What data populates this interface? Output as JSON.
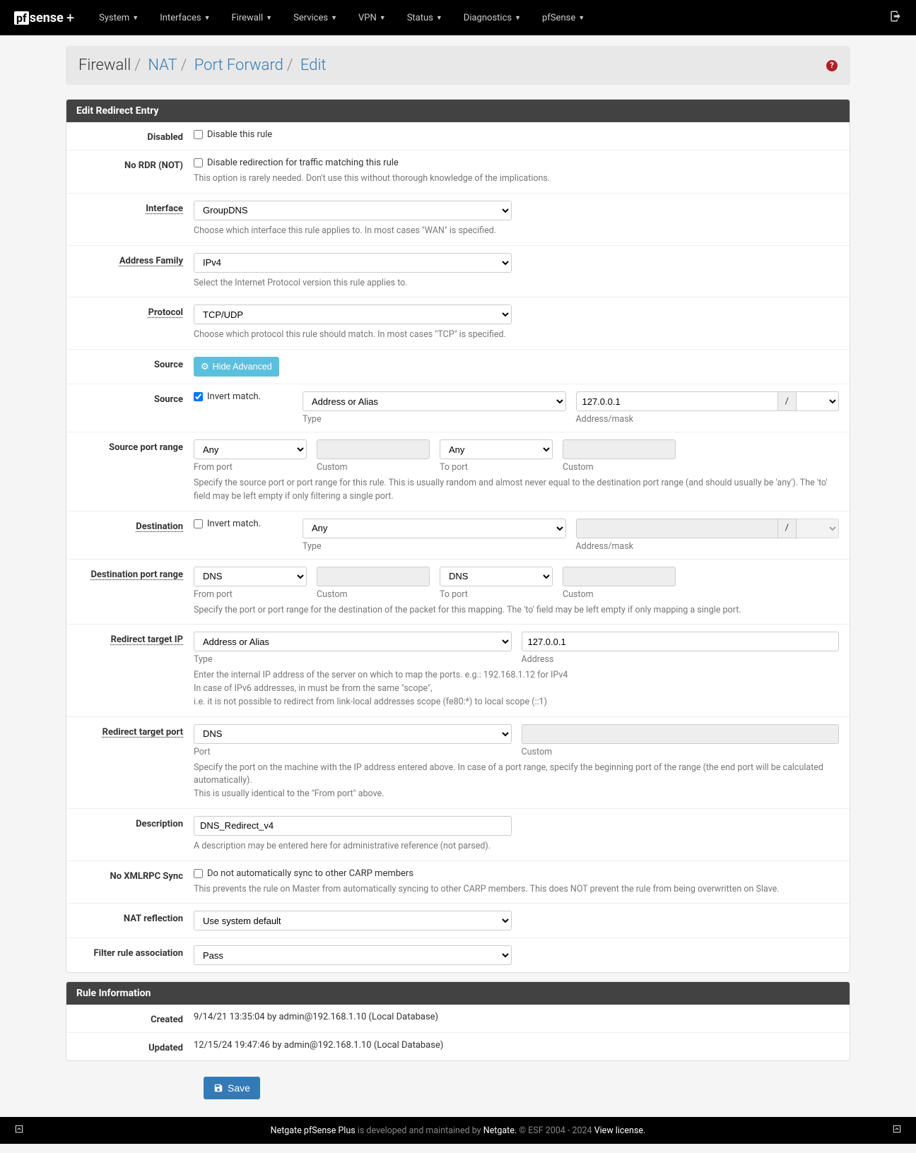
{
  "nav": {
    "logo_prefix": "pf",
    "logo_text": "sense",
    "logo_suffix": "+",
    "items": [
      "System",
      "Interfaces",
      "Firewall",
      "Services",
      "VPN",
      "Status",
      "Diagnostics",
      "pfSense"
    ]
  },
  "breadcrumb": {
    "parts": [
      "Firewall",
      "NAT",
      "Port Forward",
      "Edit"
    ]
  },
  "panel1_title": "Edit Redirect Entry",
  "panel2_title": "Rule Information",
  "fields": {
    "disabled": {
      "label": "Disabled",
      "cb_label": "Disable this rule",
      "checked": false
    },
    "nordr": {
      "label": "No RDR (NOT)",
      "cb_label": "Disable redirection for traffic matching this rule",
      "checked": false,
      "help": "This option is rarely needed. Don't use this without thorough knowledge of the implications."
    },
    "interface": {
      "label": "Interface",
      "value": "GroupDNS",
      "help": "Choose which interface this rule applies to. In most cases \"WAN\" is specified."
    },
    "addrfam": {
      "label": "Address Family",
      "value": "IPv4",
      "help": "Select the Internet Protocol version this rule applies to."
    },
    "protocol": {
      "label": "Protocol",
      "value": "TCP/UDP",
      "help": "Choose which protocol this rule should match. In most cases \"TCP\" is specified."
    },
    "source_btn": {
      "label": "Source",
      "btn": "Hide Advanced"
    },
    "source": {
      "label": "Source",
      "cb_label": "Invert match.",
      "checked": true,
      "type": "Address or Alias",
      "type_label": "Type",
      "addr": "127.0.0.1",
      "addr_label": "Address/mask"
    },
    "sport": {
      "label": "Source port range",
      "from": "Any",
      "from_label": "From port",
      "custom1_label": "Custom",
      "to": "Any",
      "to_label": "To port",
      "custom2_label": "Custom",
      "help": "Specify the source port or port range for this rule. This is usually random and almost never equal to the destination port range (and should usually be 'any'). The 'to' field may be left empty if only filtering a single port."
    },
    "dest": {
      "label": "Destination",
      "cb_label": "Invert match.",
      "checked": false,
      "type": "Any",
      "type_label": "Type",
      "addr": "",
      "addr_label": "Address/mask"
    },
    "dport": {
      "label": "Destination port range",
      "from": "DNS",
      "from_label": "From port",
      "custom1_label": "Custom",
      "to": "DNS",
      "to_label": "To port",
      "custom2_label": "Custom",
      "help": "Specify the port or port range for the destination of the packet for this mapping. The 'to' field may be left empty if only mapping a single port."
    },
    "redir_ip": {
      "label": "Redirect target IP",
      "type": "Address or Alias",
      "type_label": "Type",
      "addr": "127.0.0.1",
      "addr_label": "Address",
      "help1": "Enter the internal IP address of the server on which to map the ports. e.g.: 192.168.1.12 for IPv4",
      "help2": "In case of IPv6 addresses, in must be from the same \"scope\",",
      "help3": "i.e. it is not possible to redirect from link-local addresses scope (fe80:*) to local scope (::1)"
    },
    "redir_port": {
      "label": "Redirect target port",
      "value": "DNS",
      "port_label": "Port",
      "custom_label": "Custom",
      "help1": "Specify the port on the machine with the IP address entered above. In case of a port range, specify the beginning port of the range (the end port will be calculated automatically).",
      "help2": "This is usually identical to the \"From port\" above."
    },
    "descr": {
      "label": "Description",
      "value": "DNS_Redirect_v4",
      "help": "A description may be entered here for administrative reference (not parsed)."
    },
    "noxml": {
      "label": "No XMLRPC Sync",
      "cb_label": "Do not automatically sync to other CARP members",
      "checked": false,
      "help": "This prevents the rule on Master from automatically syncing to other CARP members. This does NOT prevent the rule from being overwritten on Slave."
    },
    "natrefl": {
      "label": "NAT reflection",
      "value": "Use system default"
    },
    "filter": {
      "label": "Filter rule association",
      "value": "Pass"
    }
  },
  "info": {
    "created": {
      "label": "Created",
      "value": "9/14/21 13:35:04 by admin@192.168.1.10 (Local Database)"
    },
    "updated": {
      "label": "Updated",
      "value": "12/15/24 19:47:46 by admin@192.168.1.10 (Local Database)"
    }
  },
  "save_btn": "Save",
  "footer": {
    "prefix": "Netgate pfSense Plus",
    "mid": " is developed and maintained by ",
    "netgate": "Netgate.",
    "copy": " © ESF 2004 - 2024 ",
    "license": "View license."
  }
}
